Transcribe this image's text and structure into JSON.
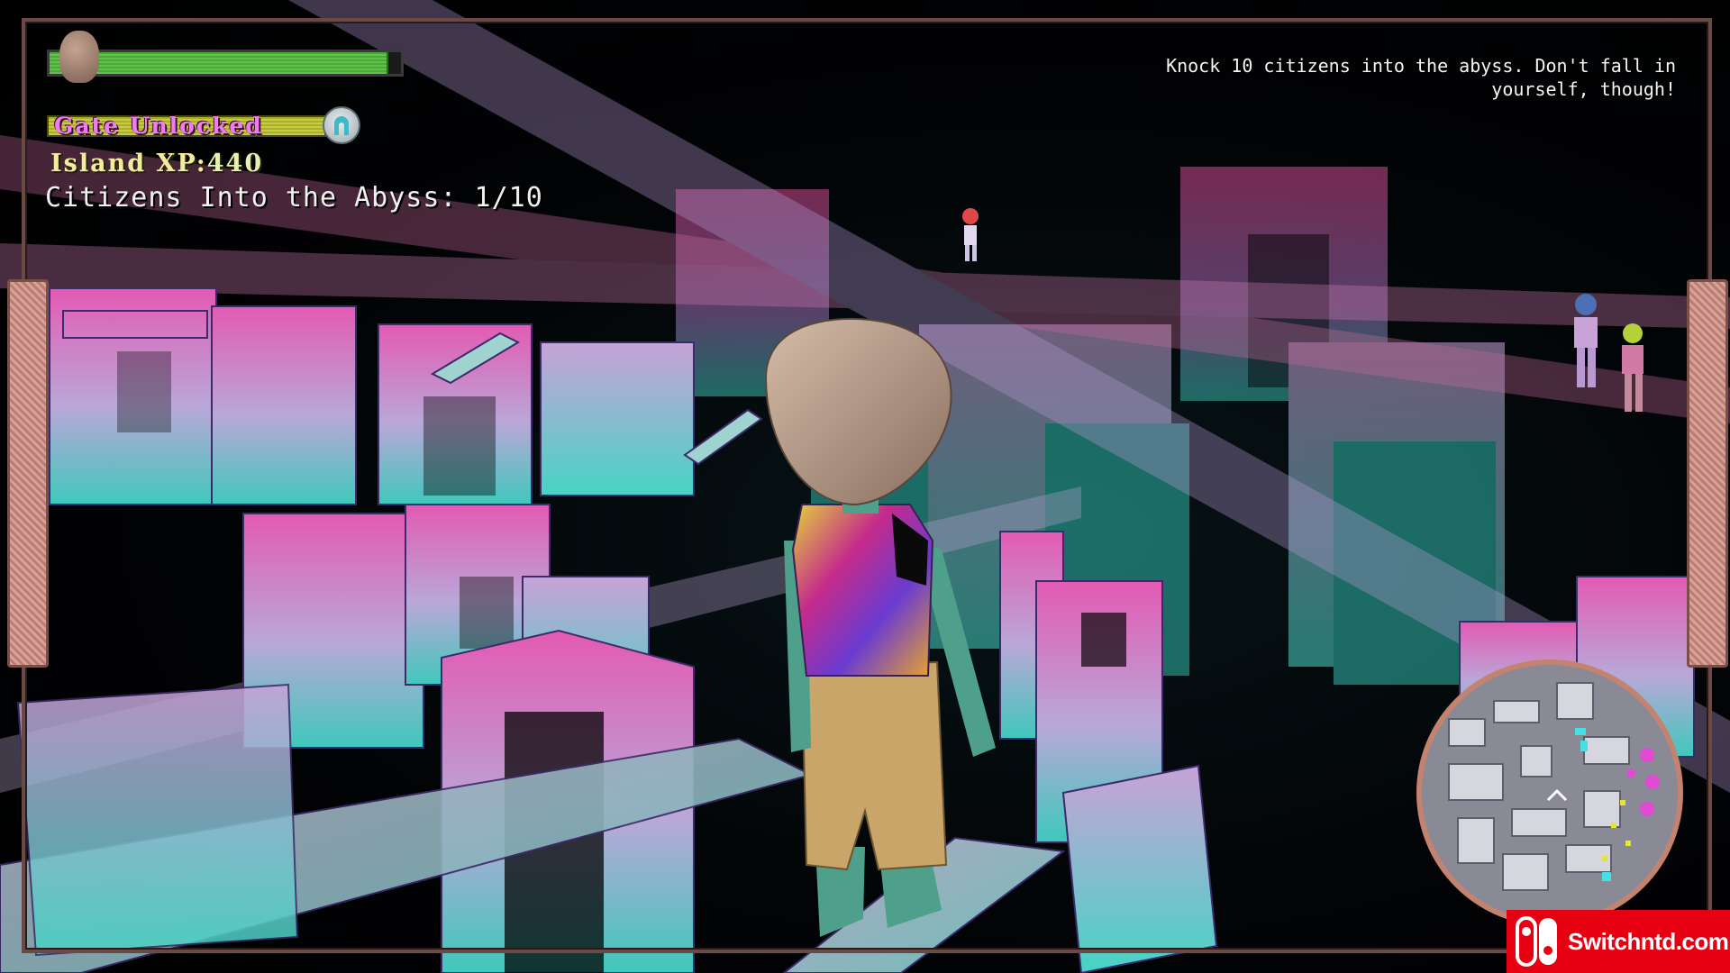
{
  "hud": {
    "health": {
      "label": "",
      "fill": 0.96,
      "icon": "player-head-icon",
      "color": "#5fc24a"
    },
    "gate": {
      "label": "Gate Unlocked",
      "icon": "gate-arch-icon",
      "bar_color": "#c8cc42",
      "text_color": "#f07cf0"
    },
    "xp": {
      "label": "Island XP:",
      "value": "440"
    },
    "counter": {
      "label": "Citizens Into the Abyss: 1/10"
    },
    "objective": {
      "line1": "Knock 10 citizens into the abyss. Don't fall in",
      "line2": "yourself, though!"
    }
  },
  "minimap": {
    "icon": "minimap",
    "border_color": "#c4836f"
  },
  "watermark": {
    "logo": "nintendo-switch-icon",
    "text": "Switchntd.com",
    "color": "#e60012"
  },
  "palette": {
    "pink": "#e35ab3",
    "cyan": "#3fc8bb",
    "lavender": "#b9a8d8"
  }
}
